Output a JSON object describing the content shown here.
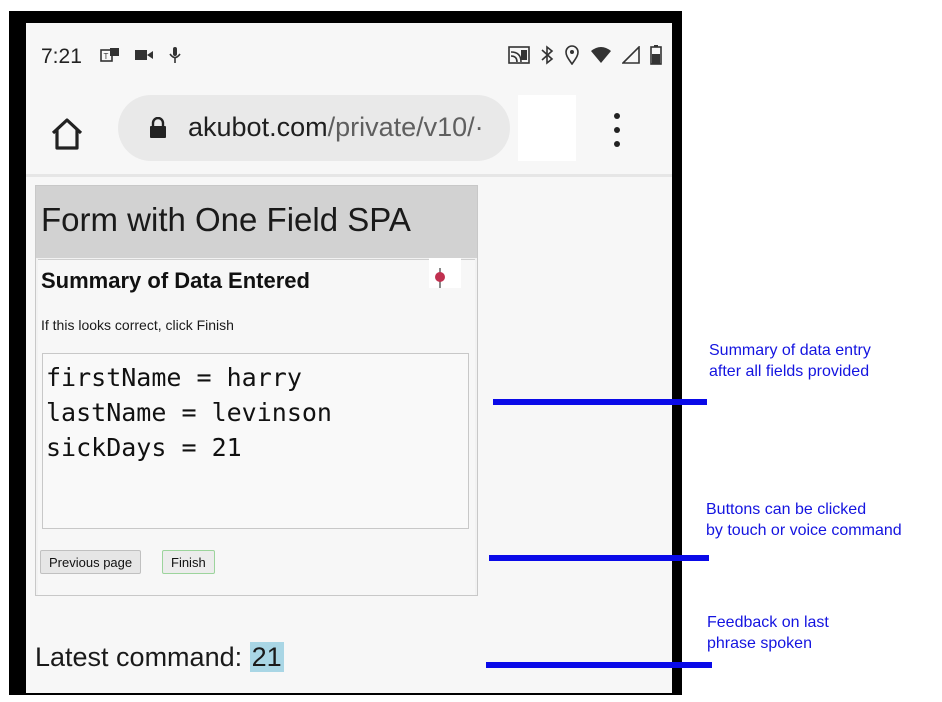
{
  "status_bar": {
    "time": "7:21",
    "icons_left": [
      "teams-notification-icon",
      "video-camera-icon",
      "microphone-icon"
    ],
    "icons_right": [
      "cast-icon",
      "bluetooth-icon",
      "location-icon",
      "wifi-icon",
      "cellular-signal-icon",
      "battery-icon"
    ]
  },
  "browser": {
    "url_host": "akubot.com",
    "url_path": "/private/v10/·"
  },
  "page": {
    "title": "Form with One Field SPA",
    "summary_heading": "Summary of Data Entered",
    "instructions": "If this looks correct, click Finish",
    "summary_lines": [
      "firstName = harry",
      "lastName = levinson",
      "sickDays = 21"
    ],
    "buttons": {
      "previous_label": "Previous page",
      "finish_label": "Finish"
    },
    "latest_command_label": "Latest command:",
    "latest_command_value": "21"
  },
  "annotations": [
    {
      "lines": [
        "Summary of data entry",
        "after all fields provided"
      ]
    },
    {
      "lines": [
        "Buttons can be clicked",
        "by touch or voice command"
      ]
    },
    {
      "lines": [
        "Feedback on last",
        "phrase spoken"
      ]
    }
  ],
  "colors": {
    "annotation_blue": "#1414e0",
    "highlight": "#a9d6e5",
    "frame": "#000000"
  }
}
